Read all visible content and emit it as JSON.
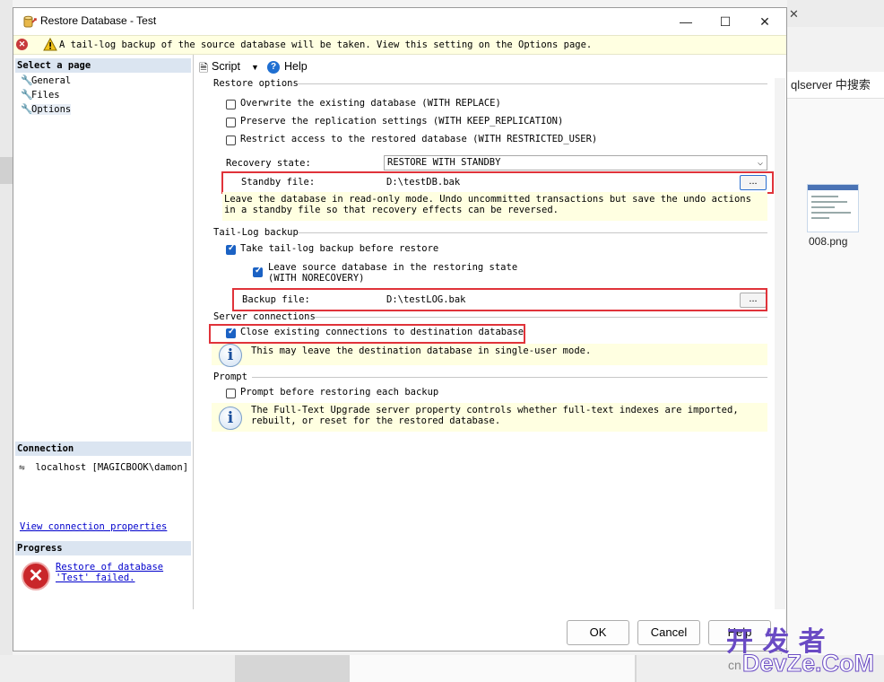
{
  "background": {
    "search_text": "qlserver 中搜索",
    "thumbnail_label": "008.png",
    "watermark_top": "开 发 者",
    "watermark_bottom": "DevZe.CoM",
    "watermark_prefix": "cn"
  },
  "window": {
    "title": "Restore Database - Test",
    "minimize": "—",
    "maximize": "☐",
    "close": "✕"
  },
  "warning": {
    "message": "A tail-log backup of the source database will be taken. View this setting on the Options page."
  },
  "left_pane": {
    "select_page_header": "Select a page",
    "pages": [
      "General",
      "Files",
      "Options"
    ],
    "connection_header": "Connection",
    "connection_server": "localhost [MAGICBOOK\\damon]",
    "view_connection_link": "View connection properties",
    "progress_header": "Progress",
    "progress_link_line1": "Restore of database",
    "progress_link_line2": "'Test' failed."
  },
  "toolbar": {
    "script_label": "Script",
    "help_label": "Help"
  },
  "restore_options": {
    "header": "Restore options",
    "overwrite": "Overwrite the existing database (WITH REPLACE)",
    "preserve": "Preserve the replication settings (WITH KEEP_REPLICATION)",
    "restrict": "Restrict access to the restored database (WITH RESTRICTED_USER)",
    "recovery_state_label": "Recovery state:",
    "recovery_state_value": "RESTORE WITH STANDBY",
    "standby_file_label": "Standby file:",
    "standby_file_value": "D:\\testDB.bak",
    "browse": "...",
    "standby_description": "Leave the database in read-only mode. Undo uncommitted transactions but save the undo actions in a standby file so that recovery effects can be reversed."
  },
  "tail_log": {
    "header": "Tail-Log backup",
    "take_tail_log": "Take tail-log backup before restore",
    "leave_source_line1": "Leave source database in the restoring state",
    "leave_source_line2": "(WITH NORECOVERY)",
    "backup_file_label": "Backup file:",
    "backup_file_value": "D:\\testLOG.bak",
    "browse": "..."
  },
  "server_connections": {
    "header": "Server connections",
    "close_existing": "Close existing connections to destination database",
    "info": "This may leave the destination database in single-user mode."
  },
  "prompt": {
    "header": "Prompt",
    "prompt_before": "Prompt before restoring each backup",
    "info": "The Full-Text Upgrade server property controls whether full-text indexes are imported, rebuilt, or reset for the restored database."
  },
  "buttons": {
    "ok": "OK",
    "cancel": "Cancel",
    "help": "Help"
  },
  "colors": {
    "highlight_box": "#e0333a",
    "section_header_bg": "#dbe5f1",
    "hint_bg": "#ffffe1",
    "checkbox_on": "#1b62c4"
  }
}
